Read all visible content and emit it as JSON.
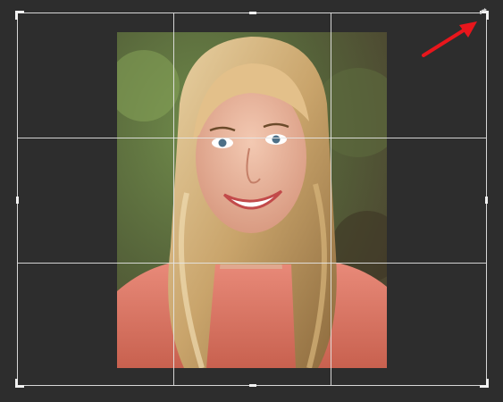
{
  "workspace": {
    "background_color": "#2d2d2d",
    "grid_color": "#e6e6e6",
    "photo_description_icon": "portrait-photo"
  },
  "crop_tool": {
    "overlay": "rule-of-thirds",
    "handles": [
      "top-left",
      "top-center",
      "top-right",
      "middle-left",
      "middle-right",
      "bottom-left",
      "bottom-center",
      "bottom-right"
    ]
  },
  "annotation": {
    "arrow_color": "#e8161c",
    "points_to": "top-right-corner-handle"
  }
}
